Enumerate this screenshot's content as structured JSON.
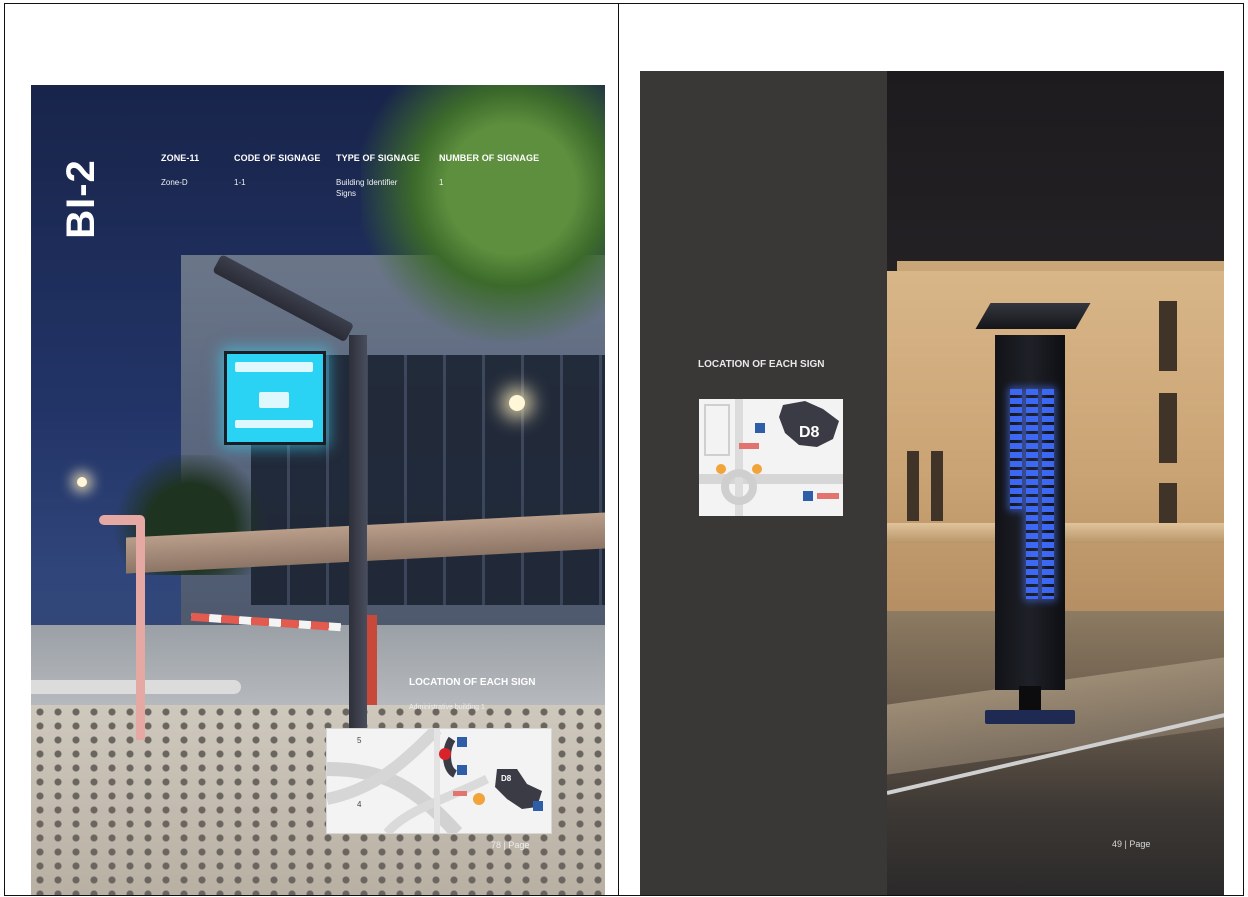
{
  "left_page": {
    "sign_code": "BI-2",
    "headers": {
      "zone": "ZONE-11",
      "code": "CODE OF SIGNAGE",
      "type": "TYPE OF SIGNAGE",
      "number": "NUMBER OF SIGNAGE"
    },
    "values": {
      "zone": "Zone-D",
      "code": "1-1",
      "type": "Building Identifier Signs",
      "number": "1"
    },
    "location_title": "LOCATION OF EACH SIGN",
    "location_subtitle": "Administrative building 1",
    "map_labels": [
      "5",
      "4",
      "D8"
    ],
    "page_label": "78 | Page"
  },
  "right_page": {
    "location_title": "LOCATION OF EACH SIGN",
    "map_label": "D8",
    "page_label": "49 | Page"
  },
  "colors": {
    "sign_cyan": "#2ad2f3",
    "dark_panel": "#3a3737",
    "led_blue": "#3f6cff",
    "map_marker": "#f0a43a",
    "map_dark": "#3b3b46",
    "parking_blue": "#2f5ea8"
  }
}
